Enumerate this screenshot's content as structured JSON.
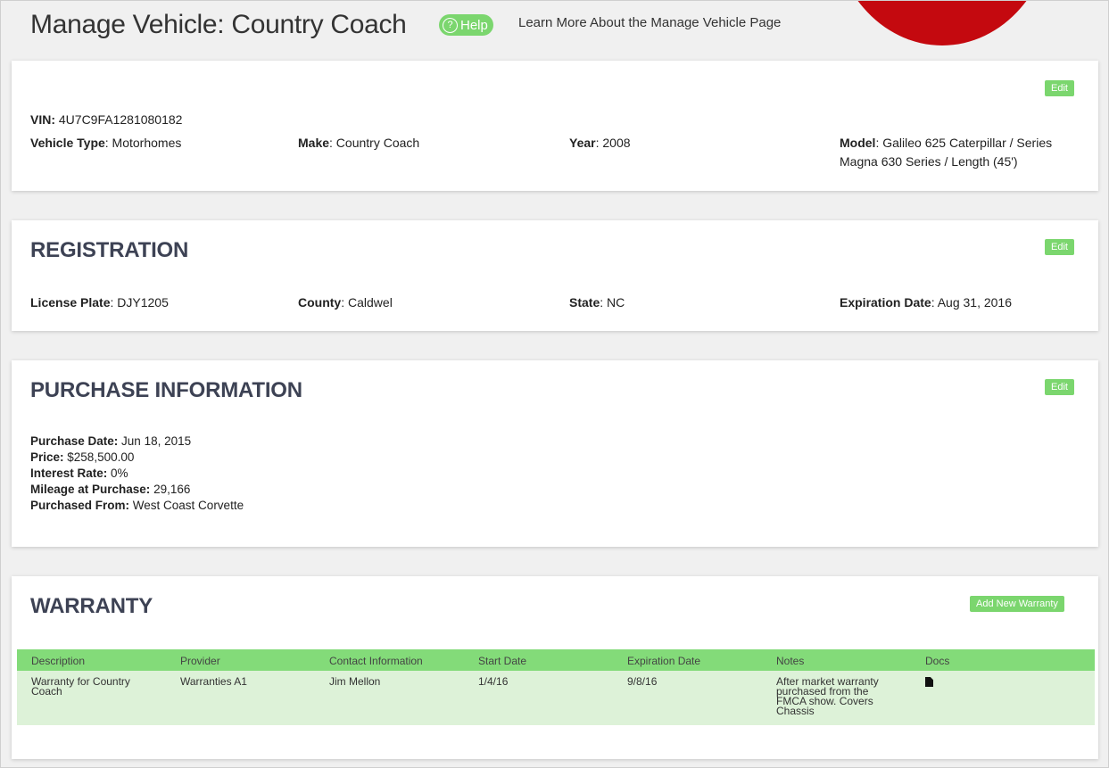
{
  "header": {
    "title": "Manage Vehicle: Country Coach",
    "help_label": "Help",
    "help_link": "Learn More About the Manage Vehicle Page",
    "accent_color": "#7bd66e",
    "brand_red": "#c4090f"
  },
  "vehicle": {
    "edit_label": "Edit",
    "vin_label": "VIN:",
    "vin": "4U7C9FA1281080182",
    "type_label": "Vehicle Type",
    "type": ": Motorhomes",
    "make_label": "Make",
    "make": ": Country Coach",
    "year_label": "Year",
    "year": ": 2008",
    "model_label": "Model",
    "model_line1": ": Galileo 625 Caterpillar / Series",
    "model_line2": "Magna 630 Series / Length (45')"
  },
  "registration": {
    "title": "REGISTRATION",
    "edit_label": "Edit",
    "plate_label": "License Plate",
    "plate": ": DJY1205",
    "county_label": "County",
    "county": ": Caldwel",
    "state_label": "State",
    "state": ": NC",
    "expiration_label": "Expiration Date",
    "expiration": ": Aug 31, 2016"
  },
  "purchase": {
    "title": "PURCHASE INFORMATION",
    "edit_label": "Edit",
    "date_label": "Purchase Date:",
    "date": " Jun 18, 2015",
    "price_label": "Price:",
    "price": " $258,500.00",
    "interest_label": "Interest Rate:",
    "interest": " 0%",
    "mileage_label": "Mileage at Purchase:",
    "mileage": " 29,166",
    "from_label": "Purchased From:",
    "from": " West Coast Corvette"
  },
  "warranty": {
    "title": "WARRANTY",
    "add_label": "Add New Warranty",
    "columns": [
      "Description",
      "Provider",
      "Contact Information",
      "Start Date",
      "Expiration Date",
      "Notes",
      "Docs"
    ],
    "rows": [
      {
        "description": "Warranty for Country Coach",
        "provider": "Warranties A1",
        "contact": "Jim Mellon",
        "start": "1/4/16",
        "expiration": "9/8/16",
        "notes": "After market warranty purchased from the FMCA show. Covers Chassis",
        "doc_icon": "document-icon"
      }
    ]
  }
}
